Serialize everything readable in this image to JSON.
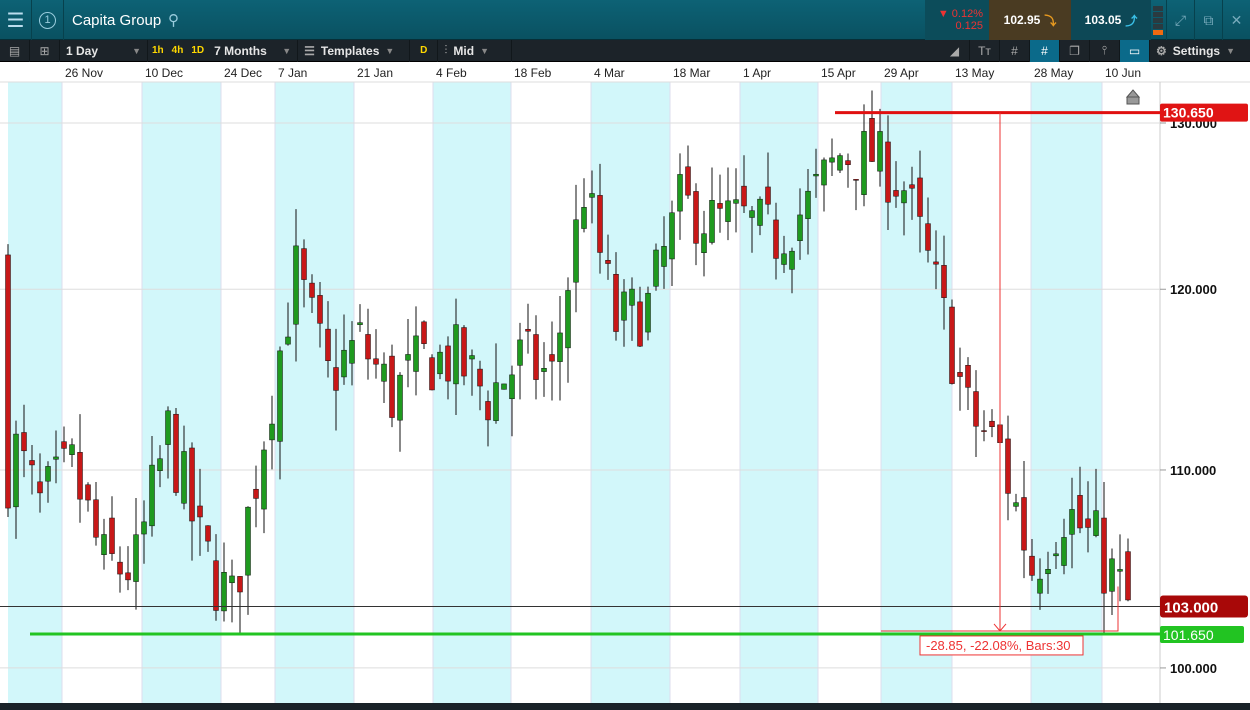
{
  "header": {
    "title": "Capita Group",
    "badge": "1",
    "change_pct": "▼ 0.12%",
    "change_abs": "0.125",
    "sell": "102.95",
    "buy": "103.05"
  },
  "toolbar": {
    "interval": "1 Day",
    "quick": [
      "1h",
      "4h",
      "1D"
    ],
    "range": "7 Months",
    "templates": "Templates",
    "d_label": "D",
    "price_type": "Mid",
    "settings": "Settings"
  },
  "colors": {
    "up": "#1f9a1f",
    "down": "#c81818",
    "band": "#d2f7fa",
    "high_line": "#e01010",
    "low_line": "#22c422"
  },
  "chart_data": {
    "type": "candlestick",
    "title": "Capita Group",
    "x_ticks": [
      "26 Nov",
      "10 Dec",
      "24 Dec",
      "7 Jan",
      "21 Jan",
      "4 Feb",
      "18 Feb",
      "4 Mar",
      "18 Mar",
      "1 Apr",
      "15 Apr",
      "29 Apr",
      "13 May",
      "28 May",
      "10 Jun"
    ],
    "y_ticks": [
      "130.000",
      "120.000",
      "110.000",
      "100.000"
    ],
    "y_tick_values": [
      130,
      120,
      110,
      100
    ],
    "ylim": [
      97.5,
      133
    ],
    "scale": "log",
    "bars": 141,
    "approx_closes_every_4_bars": [
      112,
      108,
      110,
      105,
      105,
      112,
      106,
      103,
      112,
      121,
      115,
      117,
      114,
      116,
      116,
      114,
      116,
      115,
      126,
      118,
      119,
      125,
      124,
      124,
      123,
      125,
      128,
      128,
      126,
      120,
      113,
      111,
      105,
      108,
      106,
      103
    ],
    "current_price": 103.0,
    "current_label": "103.000",
    "high_level": 130.65,
    "high_label": "130.650",
    "low_level": 101.65,
    "low_label": "101.650",
    "measurement": "-28.85, -22.08%, Bars:30"
  }
}
